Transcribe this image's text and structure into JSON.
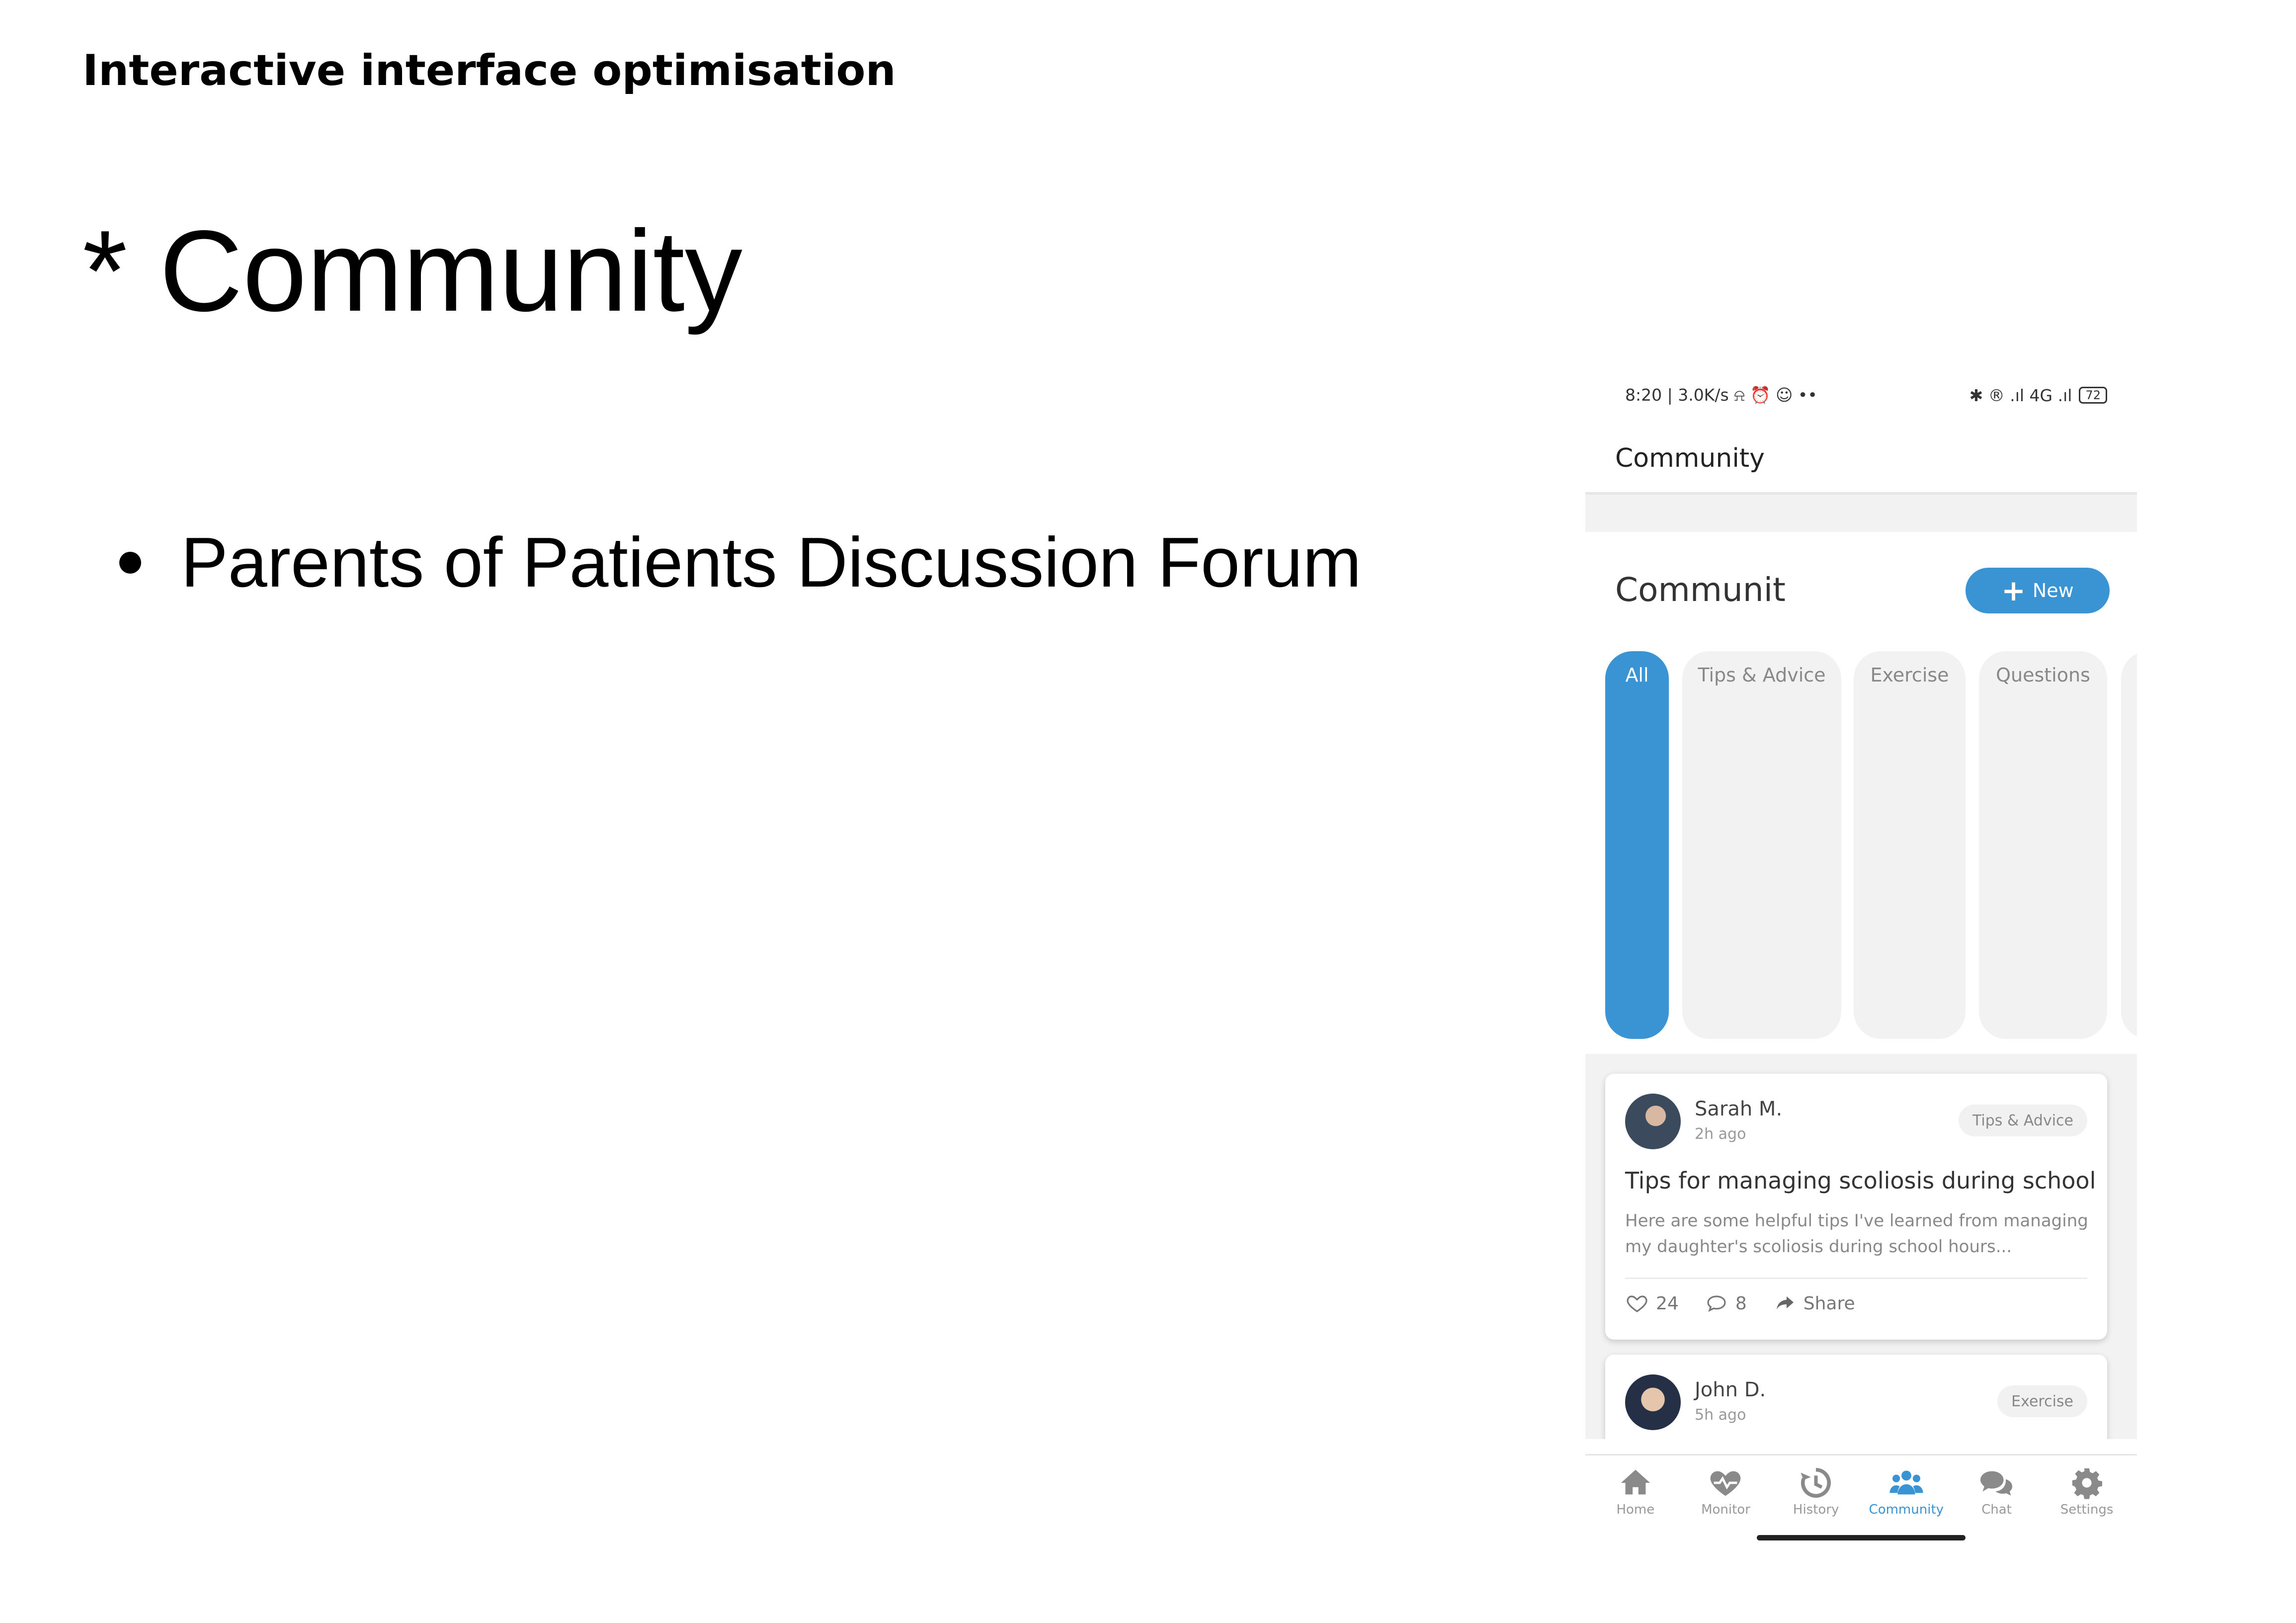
{
  "slide": {
    "subtitle": "Interactive interface optimisation",
    "title": "* Community",
    "bullet": "Parents of Patients Discussion Forum"
  },
  "phone": {
    "status": {
      "left": "8:20 | 3.0K/s ⍾ ⏰ ☺ ••",
      "right_icons": "✱ ® .ıl 4G .ıl",
      "battery": "72"
    },
    "app_bar_title": "Community",
    "community_heading": "Communit",
    "new_button": {
      "icon": "plus-icon",
      "label": "New"
    },
    "tabs": [
      {
        "label": "All",
        "active": true
      },
      {
        "label": "Tips & Advice",
        "active": false
      },
      {
        "label": "Exercise",
        "active": false
      },
      {
        "label": "Questions",
        "active": false
      }
    ],
    "posts": [
      {
        "author": "Sarah M.",
        "time": "2h ago",
        "tag": "Tips & Advice",
        "title": "Tips for managing scoliosis during school",
        "body": "Here are some helpful tips I've learned from managing my daughter's scoliosis during school hours...",
        "likes": "24",
        "comments": "8",
        "share_label": "Share"
      },
      {
        "author": "John D.",
        "time": "5h ago",
        "tag": "Exercise"
      }
    ],
    "bottom_nav": [
      {
        "label": "Home",
        "icon": "home-icon",
        "active": false
      },
      {
        "label": "Monitor",
        "icon": "heart-pulse-icon",
        "active": false
      },
      {
        "label": "History",
        "icon": "history-icon",
        "active": false
      },
      {
        "label": "Community",
        "icon": "users-icon",
        "active": true
      },
      {
        "label": "Chat",
        "icon": "chat-icon",
        "active": false
      },
      {
        "label": "Settings",
        "icon": "gear-icon",
        "active": false
      }
    ],
    "accent_color": "#3a93d2"
  }
}
